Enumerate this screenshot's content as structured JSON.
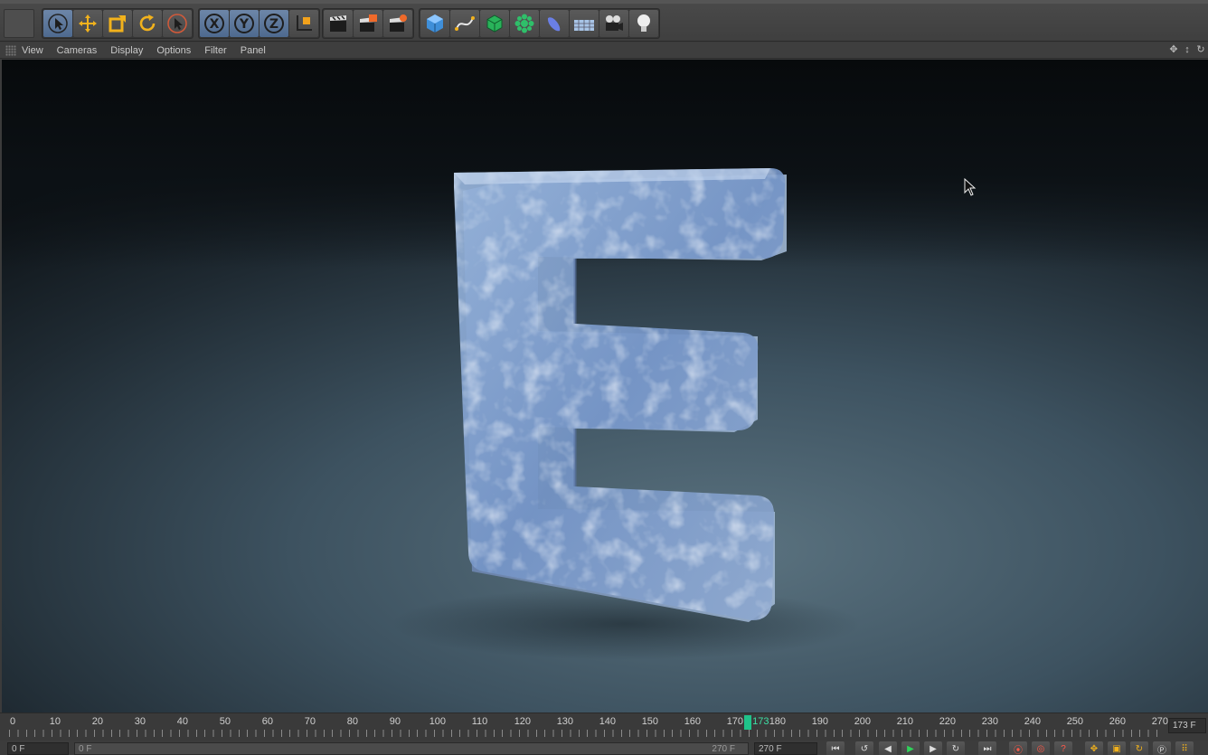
{
  "viewport_menu": [
    "View",
    "Cameras",
    "Display",
    "Options",
    "Filter",
    "Panel"
  ],
  "toolbar": {
    "tools": [
      "live-selection-icon",
      "move-icon",
      "scale-icon",
      "rotate-icon",
      "recent-tool-icon"
    ],
    "axes": [
      "X",
      "Y",
      "Z"
    ],
    "render": [
      "render-view-icon",
      "render-picture-viewer-icon",
      "edit-render-settings-icon"
    ],
    "objects": [
      "cube-icon",
      "spline-pen-icon",
      "subdivision-icon",
      "cloner-icon",
      "deformer-icon",
      "floor-icon",
      "camera-icon",
      "light-icon"
    ]
  },
  "timeline": {
    "ticks": [
      "0",
      "10",
      "20",
      "30",
      "40",
      "50",
      "60",
      "70",
      "80",
      "90",
      "100",
      "110",
      "120",
      "130",
      "140",
      "150",
      "160",
      "170",
      "173",
      "180",
      "190",
      "200",
      "210",
      "220",
      "230",
      "240",
      "250",
      "260",
      "270"
    ],
    "current_frame": 173,
    "max_frame": 270,
    "current_frame_label": "173 F"
  },
  "controls": {
    "start_frame": "0 F",
    "range_start": "0 F",
    "range_end": "270 F",
    "end_frame": "270 F"
  },
  "colors": {
    "accent": "#1fc38a",
    "active_tool": "#5a79a3"
  }
}
